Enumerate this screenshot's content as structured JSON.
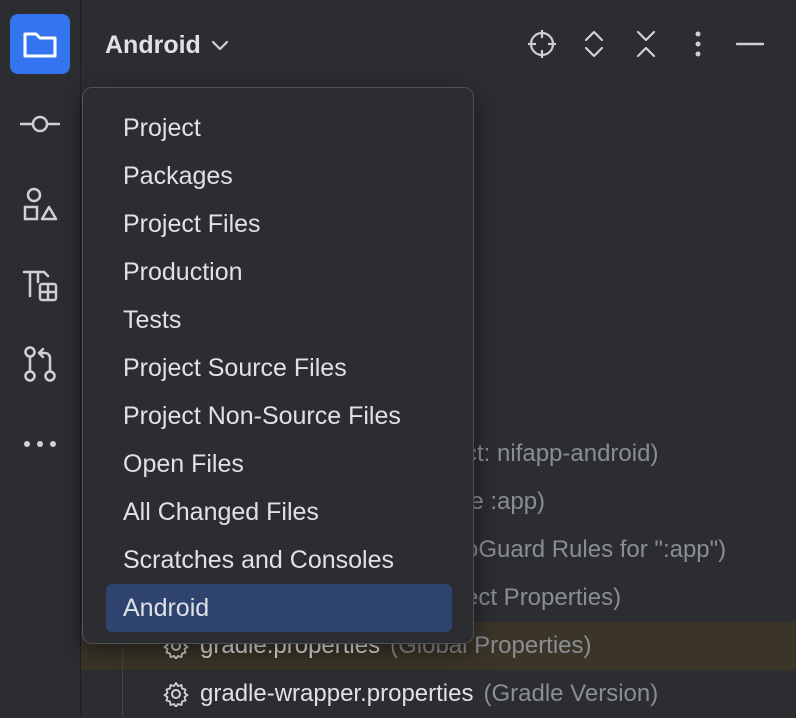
{
  "header": {
    "view_title": "Android"
  },
  "icons": {
    "toolstrip": [
      "folder-icon",
      "commit-icon",
      "structure-icon",
      "build-variants-icon",
      "pull-requests-icon",
      "more-icon"
    ],
    "header": [
      "chevron-down-icon",
      "locate-icon",
      "expand-all-icon",
      "collapse-all-icon",
      "options-icon",
      "hide-icon"
    ]
  },
  "tree": {
    "rows": [
      {
        "name": "",
        "hint": "ct: nifapp-android)"
      },
      {
        "name": "",
        "hint": "le :app)"
      },
      {
        "name": "",
        "hint": "oGuard Rules for \":app\")"
      },
      {
        "name": "",
        "hint": "ect Properties)"
      },
      {
        "name": "gradle.properties",
        "hint": "(Global Properties)"
      },
      {
        "name": "gradle-wrapper.properties",
        "hint": "(Gradle Version)"
      }
    ]
  },
  "popup": {
    "items": [
      "Project",
      "Packages",
      "Project Files",
      "Production",
      "Tests",
      "Project Source Files",
      "Project Non-Source Files",
      "Open Files",
      "All Changed Files",
      "Scratches and Consoles",
      "Android"
    ],
    "selected": "Android"
  },
  "colors": {
    "background": "#2b2d30",
    "accent": "#3574f0",
    "selection": "#2e436e",
    "text": "#dfe1e5",
    "muted_text": "#8a8d93",
    "highlight_row": "#3b3528"
  }
}
